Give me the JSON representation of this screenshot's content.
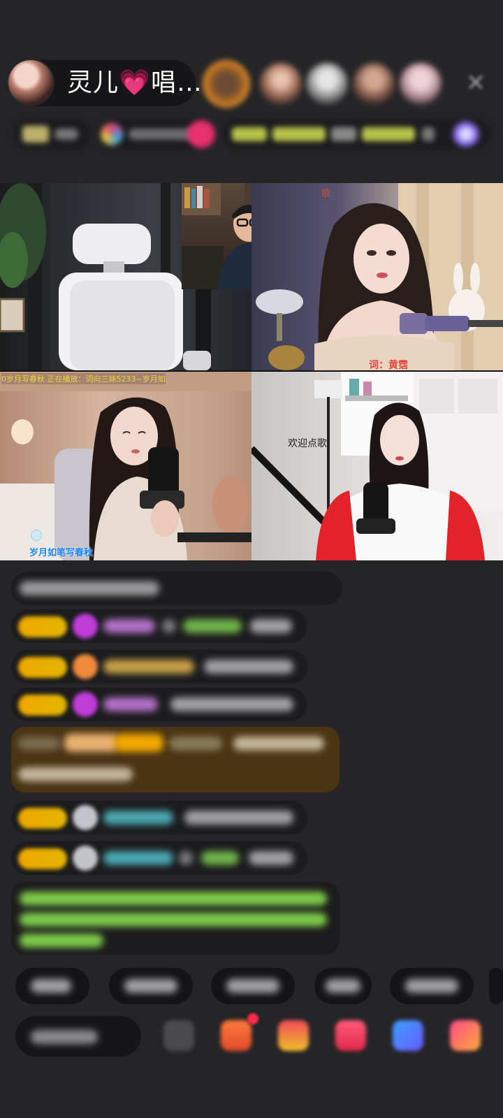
{
  "header": {
    "host_name": "灵儿💗唱…",
    "close_label": "✕"
  },
  "video": {
    "cells": [
      {
        "name": "guest-empty-chair",
        "label": ""
      },
      {
        "name": "guest-studio-man",
        "label": ""
      },
      {
        "name": "guest-singer-right",
        "label": "词：黄霑"
      },
      {
        "name": "guest-singer-left",
        "label": "岁月如笔写春秋",
        "marquee": "0岁月写春秋  正在播放：词向三妹5233~岁月如"
      },
      {
        "name": "guest-singer-red",
        "label": "欢迎点歌"
      }
    ],
    "top_right_fragment": "歌"
  },
  "colors": {
    "background": "#252527",
    "badge": "#f0a800",
    "green_text": "#7ec94a",
    "highlight_row": "#4a3414"
  }
}
